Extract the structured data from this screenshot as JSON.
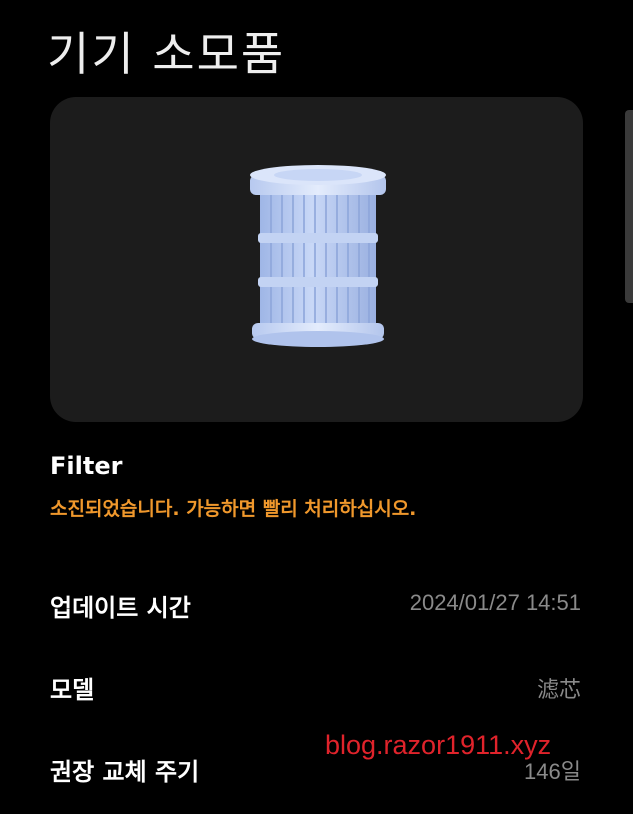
{
  "page": {
    "title": "기기 소모품"
  },
  "consumable": {
    "image_icon": "filter-cartridge-icon",
    "name": "Filter",
    "status": "소진되었습니다. 가능하면 빨리 처리하십시오.",
    "status_color": "#f0982c"
  },
  "details": {
    "update_label": "업데이트 시간",
    "update_value": "2024/01/27 14:51",
    "model_label": "모델",
    "model_value": "滤芯",
    "cycle_label": "권장 교체 주기",
    "cycle_value": "146일"
  },
  "watermark": {
    "text": "blog.razor1911.xyz",
    "color": "#e0232b"
  }
}
